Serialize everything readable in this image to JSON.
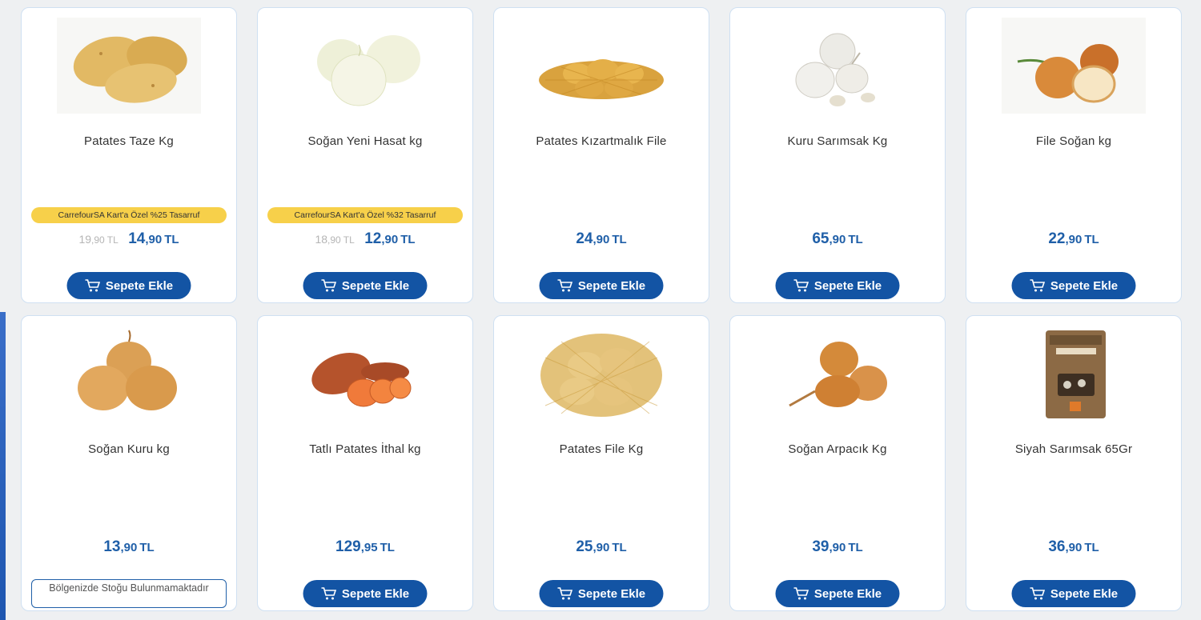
{
  "products": [
    {
      "name": "Patates Taze Kg",
      "icon": "potato-icon",
      "badge": "CarrefourSA Kart'a Özel  %25 Tasarruf",
      "old_int": "19",
      "old_dec": ",90",
      "new_int": "14",
      "new_dec": ",90",
      "currency": "TL",
      "button": "Sepete Ekle"
    },
    {
      "name": "Soğan Yeni Hasat kg",
      "icon": "white-onion-icon",
      "badge": "CarrefourSA Kart'a Özel  %32 Tasarruf",
      "old_int": "18",
      "old_dec": ",90",
      "new_int": "12",
      "new_dec": ",90",
      "currency": "TL",
      "button": "Sepete Ekle"
    },
    {
      "name": "Patates Kızartmalık File",
      "icon": "potato-net-icon",
      "new_int": "24",
      "new_dec": ",90",
      "currency": "TL",
      "button": "Sepete Ekle"
    },
    {
      "name": "Kuru Sarımsak Kg",
      "icon": "garlic-icon",
      "new_int": "65",
      "new_dec": ",90",
      "currency": "TL",
      "button": "Sepete Ekle"
    },
    {
      "name": "File Soğan kg",
      "icon": "onion-icon",
      "new_int": "22",
      "new_dec": ",90",
      "currency": "TL",
      "button": "Sepete Ekle"
    },
    {
      "name": "Soğan Kuru kg",
      "icon": "onion-icon",
      "new_int": "13",
      "new_dec": ",90",
      "currency": "TL",
      "out_of_stock": "Bölgenizde Stoğu Bulunmamaktadır"
    },
    {
      "name": "Tatlı Patates İthal kg",
      "icon": "sweet-potato-icon",
      "new_int": "129",
      "new_dec": ",95",
      "currency": "TL",
      "button": "Sepete Ekle"
    },
    {
      "name": "Patates File  Kg",
      "icon": "potato-net-icon",
      "new_int": "25",
      "new_dec": ",90",
      "currency": "TL",
      "button": "Sepete Ekle"
    },
    {
      "name": "Soğan Arpacık Kg",
      "icon": "shallot-icon",
      "new_int": "39",
      "new_dec": ",90",
      "currency": "TL",
      "button": "Sepete Ekle"
    },
    {
      "name": "Siyah Sarımsak 65Gr",
      "icon": "black-garlic-pack-icon",
      "new_int": "36",
      "new_dec": ",90",
      "currency": "TL",
      "button": "Sepete Ekle"
    }
  ],
  "colors": {
    "accent": "#1354a4",
    "price": "#1f5fa8",
    "badge": "#f7d04a"
  }
}
